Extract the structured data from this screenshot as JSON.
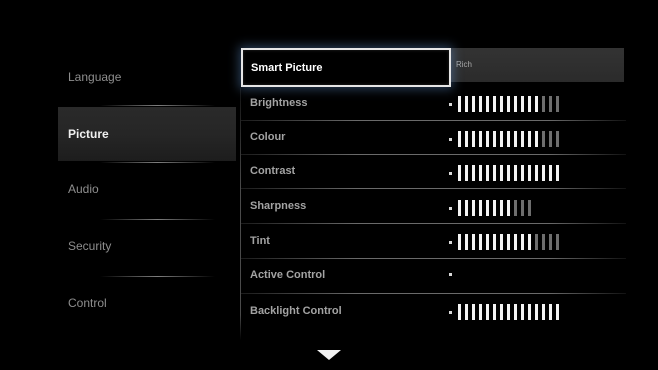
{
  "categories": [
    {
      "label": "Language",
      "selected": false
    },
    {
      "label": "Picture",
      "selected": true
    },
    {
      "label": "Audio",
      "selected": false
    },
    {
      "label": "Security",
      "selected": false
    },
    {
      "label": "Control",
      "selected": false
    }
  ],
  "settings": {
    "smart_picture": {
      "label": "Smart Picture",
      "value": "Rich"
    },
    "brightness": {
      "label": "Brightness",
      "level": 12,
      "max": 15
    },
    "colour": {
      "label": "Colour",
      "level": 12,
      "max": 15
    },
    "contrast": {
      "label": "Contrast",
      "level": 15,
      "max": 15
    },
    "sharpness": {
      "label": "Sharpness",
      "level": 8,
      "max": 11
    },
    "tint": {
      "label": "Tint",
      "level": 11,
      "max": 15
    },
    "active_control": {
      "label": "Active Control"
    },
    "backlight_control": {
      "label": "Backlight Control",
      "level": 15,
      "max": 15
    }
  },
  "icons": {
    "scroll_down": "down-triangle-icon"
  },
  "colors": {
    "background": "#000000",
    "focus_border": "#e6e6e6",
    "bar_on": "#f4f4f4",
    "bar_off": "#6e6e6e"
  }
}
